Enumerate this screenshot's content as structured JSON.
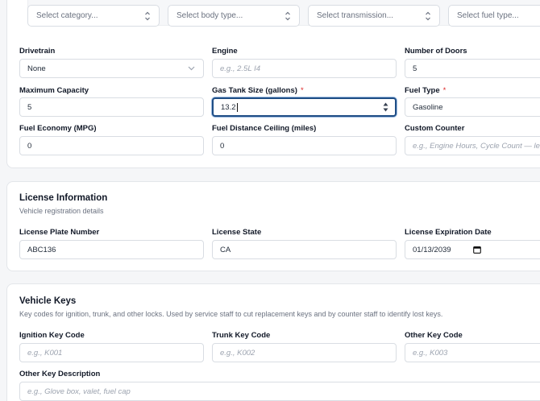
{
  "filters": {
    "category_placeholder": "Select category...",
    "body_type_placeholder": "Select body type...",
    "transmission_placeholder": "Select transmission...",
    "fuel_type_placeholder": "Select fuel type..."
  },
  "specs": {
    "drivetrain": {
      "label": "Drivetrain",
      "value": "None"
    },
    "engine": {
      "label": "Engine",
      "placeholder": "e.g., 2.5L I4"
    },
    "doors": {
      "label": "Number of Doors",
      "value": "5"
    },
    "capacity": {
      "label": "Maximum Capacity",
      "value": "5"
    },
    "gas_tank": {
      "label": "Gas Tank Size (gallons)",
      "required_mark": "*",
      "value": "13.2"
    },
    "fuel_type": {
      "label": "Fuel Type",
      "required_mark": "*",
      "value": "Gasoline"
    },
    "fuel_economy": {
      "label": "Fuel Economy (MPG)",
      "value": "0"
    },
    "fuel_distance": {
      "label": "Fuel Distance Ceiling (miles)",
      "value": "0"
    },
    "custom_counter": {
      "label": "Custom Counter",
      "placeholder": "e.g., Engine Hours, Cycle Count — leave"
    }
  },
  "license": {
    "title": "License Information",
    "subtitle": "Vehicle registration details",
    "plate": {
      "label": "License Plate Number",
      "value": "ABC136"
    },
    "state": {
      "label": "License State",
      "value": "CA"
    },
    "expiration": {
      "label": "License Expiration Date",
      "value": "01/13/2039"
    }
  },
  "keys": {
    "title": "Vehicle Keys",
    "subtitle": "Key codes for ignition, trunk, and other locks. Used by service staff to cut replacement keys and by counter staff to identify lost keys.",
    "ignition": {
      "label": "Ignition Key Code",
      "placeholder": "e.g., K001"
    },
    "trunk": {
      "label": "Trunk Key Code",
      "placeholder": "e.g., K002"
    },
    "other": {
      "label": "Other Key Code",
      "placeholder": "e.g., K003"
    },
    "other_desc": {
      "label": "Other Key Description",
      "placeholder": "e.g., Glove box, valet, fuel cap"
    }
  },
  "colors": {
    "focus_border": "#1f4e86",
    "required": "#dc2626"
  }
}
